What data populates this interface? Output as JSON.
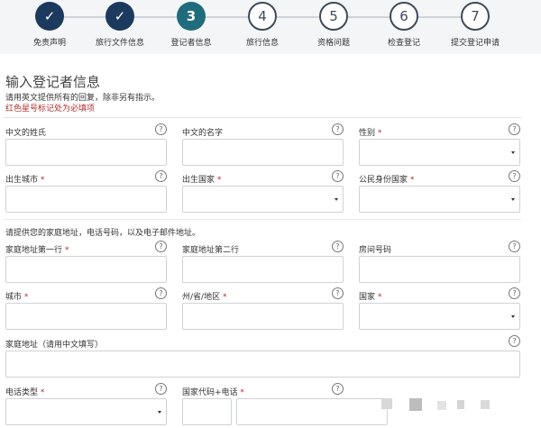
{
  "stepper": {
    "steps": [
      {
        "symbol": "✓",
        "label": "免责声明",
        "state": "done"
      },
      {
        "symbol": "✓",
        "label": "旅行文件信息",
        "state": "done"
      },
      {
        "symbol": "3",
        "label": "登记者信息",
        "state": "current"
      },
      {
        "symbol": "4",
        "label": "旅行信息",
        "state": "todo"
      },
      {
        "symbol": "5",
        "label": "资格问题",
        "state": "todo"
      },
      {
        "symbol": "6",
        "label": "检查登记",
        "state": "todo"
      },
      {
        "symbol": "7",
        "label": "提交登记申请",
        "state": "todo"
      }
    ]
  },
  "form": {
    "title": "输入登记者信息",
    "instructions": "请用英文提供所有的回复，除非另有指示。",
    "required_note": "红色星号标记处为必填项",
    "address_note": "请提供您的家庭地址，电话号码，以及电子邮件地址。",
    "help_symbol": "?",
    "fields": {
      "surname_cn": {
        "label": "中文的姓氏"
      },
      "given_name_cn": {
        "label": "中文的名字"
      },
      "gender": {
        "label": "性别 *"
      },
      "birth_city": {
        "label": "出生城市 *"
      },
      "birth_country": {
        "label": "出生国家 *"
      },
      "citizenship": {
        "label": "公民身份国家 *"
      },
      "address_line1": {
        "label": "家庭地址第一行 *"
      },
      "address_line2": {
        "label": "家庭地址第二行"
      },
      "room_number": {
        "label": "房间号码"
      },
      "city": {
        "label": "城市 *"
      },
      "state": {
        "label": "州/省/地区 *"
      },
      "country": {
        "label": "国家 *"
      },
      "address_cn": {
        "label": "家庭地址（请用中文填写）"
      },
      "phone_type": {
        "label": "电话类型 *"
      },
      "country_code_phone": {
        "label": "国家代码+电话 *"
      }
    }
  },
  "colors": {
    "done": "#1c3a5e",
    "current": "#1f6c7c",
    "required": "#b03030",
    "input_border": "#cfd2d6"
  }
}
